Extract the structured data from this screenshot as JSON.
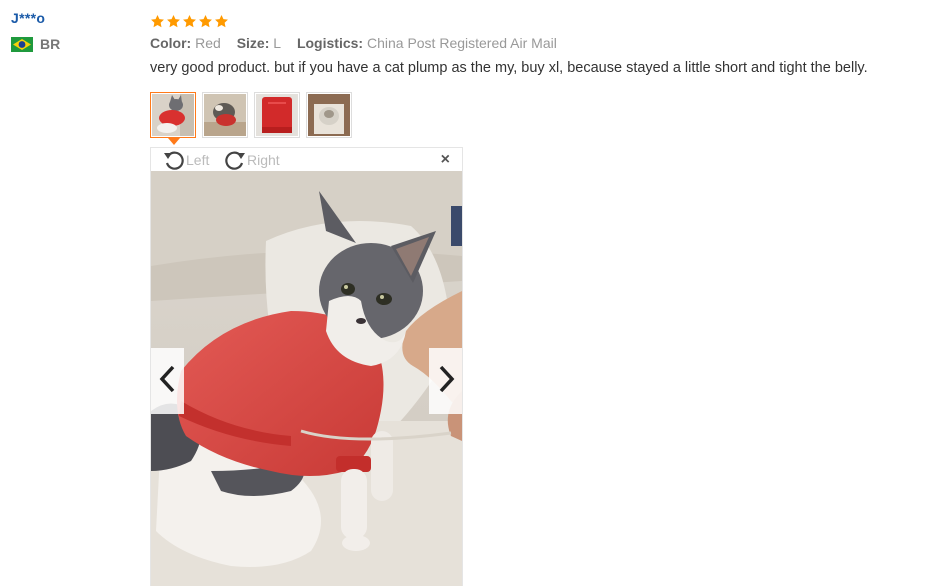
{
  "user": {
    "name": "J***o",
    "country_code": "BR",
    "flag_icon": "brazil-flag-icon"
  },
  "rating": {
    "stars": 5,
    "max": 5,
    "color": "#ff9a00"
  },
  "attributes": [
    {
      "key": "Color:",
      "value": "Red"
    },
    {
      "key": "Size:",
      "value": "L"
    },
    {
      "key": "Logistics:",
      "value": "China Post Registered Air Mail"
    }
  ],
  "review_text": "very good product. but if you have a cat plump as the my, buy xl, because stayed a little short and tight the belly.",
  "thumbnails": [
    {
      "icon": "cat-in-red-sweater-photo",
      "active": true
    },
    {
      "icon": "cat-on-blanket-photo",
      "active": false
    },
    {
      "icon": "red-sweater-photo",
      "active": false
    },
    {
      "icon": "cat-on-bed-photo",
      "active": false
    }
  ],
  "viewer": {
    "rotate_left_label": "Left",
    "rotate_right_label": "Right",
    "close_label": "×",
    "prev_icon": "chevron-left-icon",
    "next_icon": "chevron-right-icon"
  },
  "colors": {
    "username": "#1a5aa8",
    "accent": "#ff7a1a",
    "meta_text": "#999999"
  }
}
